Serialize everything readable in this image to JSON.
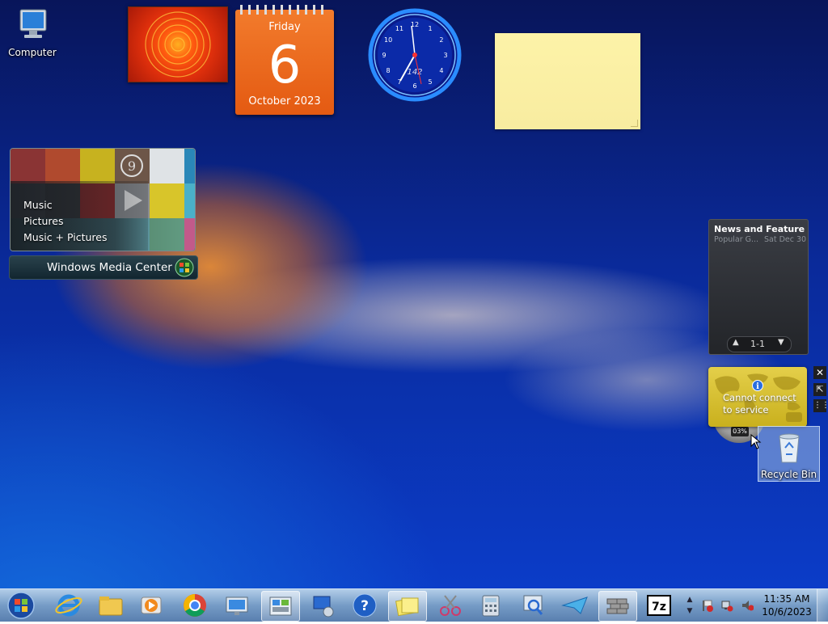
{
  "desktop": {
    "icons": {
      "computer": "Computer",
      "recycle_bin": "Recycle Bin"
    }
  },
  "gadgets": {
    "calendar": {
      "day": "Friday",
      "date": "6",
      "month_year": "October 2023"
    },
    "clock": {
      "text": "142",
      "numerals": [
        "12",
        "1",
        "2",
        "3",
        "4",
        "5",
        "6",
        "7",
        "8",
        "9",
        "10",
        "11"
      ]
    },
    "media_center": {
      "items": [
        "Music",
        "Pictures",
        "Music + Pictures"
      ],
      "brand_strong": "Windows",
      "brand_light": " Media Center"
    },
    "news": {
      "title": "News and Features f...",
      "source": "Popular G...",
      "date": "Sat Dec 30",
      "pager": "1-1"
    },
    "weather": {
      "message_line1": "Cannot connect",
      "message_line2": "to service"
    },
    "cpu_meter": {
      "value": "03%"
    },
    "controls": {
      "close": "✕",
      "resize": "⇱",
      "drag": "⋮⋮"
    }
  },
  "taskbar": {
    "pinned": [
      "start-orb-icon",
      "internet-explorer-icon",
      "file-explorer-icon",
      "media-player-icon",
      "chrome-icon",
      "remote-desktop-icon",
      "control-panel-icon",
      "network-icon",
      "help-icon",
      "sticky-notes-icon",
      "snipping-tool-icon",
      "calculator-icon",
      "search-icon",
      "paper-plane-icon",
      "firewall-icon",
      "7zip-icon"
    ],
    "seven_zip_label": "7z",
    "help_label": "?",
    "clock_time": "11:35 AM",
    "clock_date": "10/6/2023"
  }
}
